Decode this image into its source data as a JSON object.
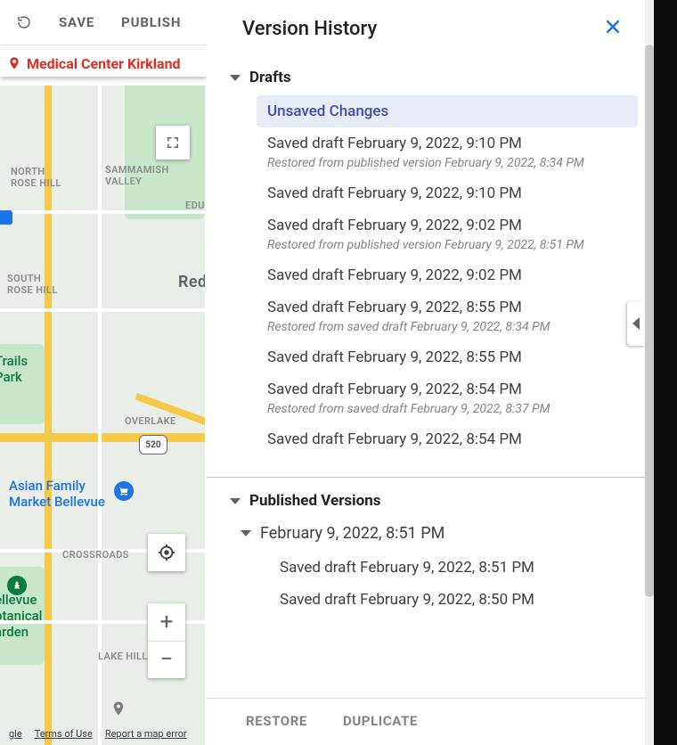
{
  "toolbar": {
    "save": "SAVE",
    "publish": "PUBLISH"
  },
  "location_tag": "Medical Center Kirkland",
  "map": {
    "labels": {
      "north_rose_hill": "NORTH\nROSE HILL",
      "sammamish_valley": "SAMMAMISH\nVALLEY",
      "edu": "EDU",
      "redm": "Redm",
      "south_rose_hill": "SOUTH\nROSE HILL",
      "overlake": "OVERLAKE",
      "crossroads": "CROSSROADS",
      "lake_hill": "LAKE HILL",
      "trails_park": "Trails\nPark",
      "asian_family": "Asian Family\nMarket Bellevue",
      "botanical": "ellevue\notanical\narden",
      "shield_520": "520"
    },
    "footer": {
      "lang": "gle",
      "terms": "Terms of Use",
      "report": "Report a map error"
    }
  },
  "panel": {
    "title": "Version History",
    "sections": {
      "drafts": {
        "label": "Drafts",
        "entries": [
          {
            "title": "Unsaved Changes",
            "selected": true
          },
          {
            "title": "Saved draft February 9, 2022, 9:10 PM",
            "sub": "Restored from published version February 9, 2022, 8:34 PM"
          },
          {
            "title": "Saved draft February 9, 2022, 9:10 PM"
          },
          {
            "title": "Saved draft February 9, 2022, 9:02 PM",
            "sub": "Restored from published version February 9, 2022, 8:51 PM"
          },
          {
            "title": "Saved draft February 9, 2022, 9:02 PM"
          },
          {
            "title": "Saved draft February 9, 2022, 8:55 PM",
            "sub": "Restored from saved draft February 9, 2022, 8:34 PM"
          },
          {
            "title": "Saved draft February 9, 2022, 8:55 PM"
          },
          {
            "title": "Saved draft February 9, 2022, 8:54 PM",
            "sub": "Restored from saved draft February 9, 2022, 8:37 PM"
          },
          {
            "title": "Saved draft February 9, 2022, 8:54 PM"
          }
        ]
      },
      "published": {
        "label": "Published Versions",
        "entries": [
          {
            "title": "February 9, 2022, 8:51 PM",
            "expandable": true,
            "children": [
              {
                "title": "Saved draft February 9, 2022, 8:51 PM"
              },
              {
                "title": "Saved draft February 9, 2022, 8:50 PM"
              }
            ]
          }
        ]
      }
    },
    "footer": {
      "restore": "RESTORE",
      "duplicate": "DUPLICATE"
    }
  }
}
